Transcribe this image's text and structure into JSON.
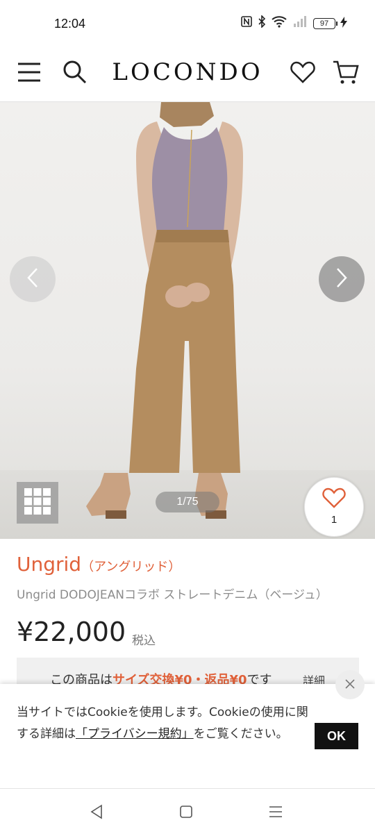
{
  "status_bar": {
    "time": "12:04",
    "icons": [
      "nfc-icon",
      "bluetooth-icon",
      "wifi-icon",
      "signal-icon"
    ],
    "battery": "97"
  },
  "header": {
    "logo": "LOCONDO",
    "icons": [
      "menu-icon",
      "search-icon",
      "heart-icon",
      "cart-icon"
    ]
  },
  "gallery": {
    "counter": "1/75",
    "favorite_count": "1",
    "icons": [
      "chevron-left-icon",
      "chevron-right-icon",
      "grid-icon",
      "heart-outline-icon"
    ]
  },
  "product": {
    "brand": "Ungrid",
    "brand_kana": "（アングリッド）",
    "name": "Ungrid DODOJEANコラボ ストレートデニム（ベージュ）",
    "price": "¥22,000",
    "tax": "税込"
  },
  "notice": {
    "prefix": "この商品は",
    "highlight": "サイズ交換¥0・返品¥0",
    "suffix": "です",
    "link": "詳細"
  },
  "cookie": {
    "text_before": "当サイトではCookieを使用します。Cookieの使用に関する詳細は",
    "link": "「プライバシー規約」",
    "text_after": "をご覧ください。",
    "ok": "OK"
  },
  "colors": {
    "brand_accent": "#e0613a",
    "ok_button": "#111111"
  },
  "nav": [
    "back-icon",
    "home-icon",
    "recents-icon"
  ]
}
